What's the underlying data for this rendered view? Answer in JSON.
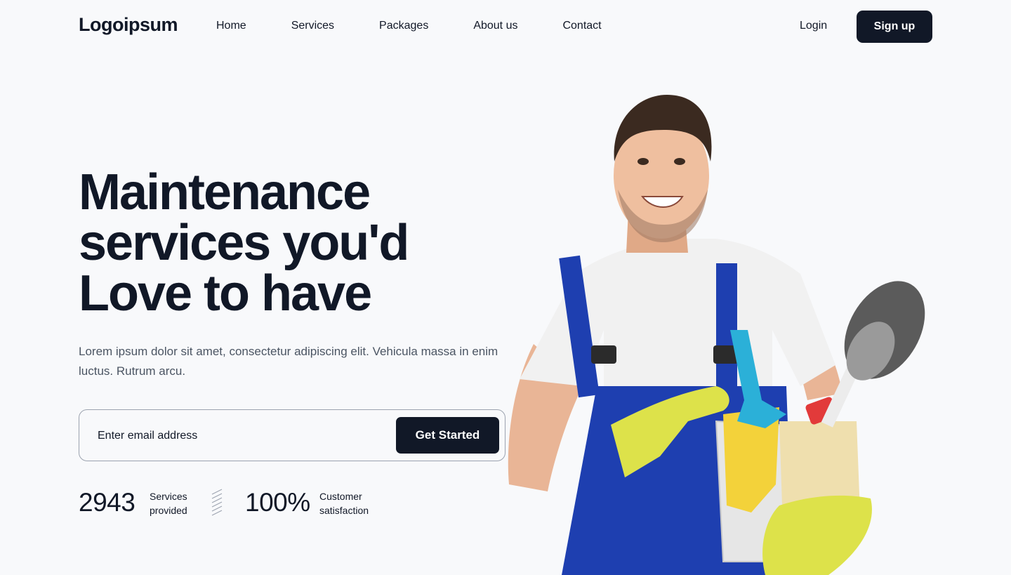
{
  "nav": {
    "logo": "Logoipsum",
    "links": [
      "Home",
      "Services",
      "Packages",
      "About us",
      "Contact"
    ],
    "login": "Login",
    "signup": "Sign up"
  },
  "hero": {
    "headline": [
      "Maintenance",
      "services you'd",
      "Love to have"
    ],
    "subtitle": "Lorem ipsum dolor sit amet, consectetur adipiscing elit. Vehicula massa in enim luctus. Rutrum arcu.",
    "email_placeholder": "Enter email address",
    "cta": "Get Started"
  },
  "stats": [
    {
      "value": "2943",
      "label_line1": "Services",
      "label_line2": "provided"
    },
    {
      "value": "100%",
      "label_line1": "Customer",
      "label_line2": "satisfaction"
    }
  ],
  "icons": {
    "divider": "diagonal-hatch-icon"
  },
  "colors": {
    "primary": "#111827",
    "background": "#f8f9fb",
    "text_muted": "#4b5563",
    "overall_blue": "#1e3fb0",
    "glove_yellow": "#dde24a"
  }
}
